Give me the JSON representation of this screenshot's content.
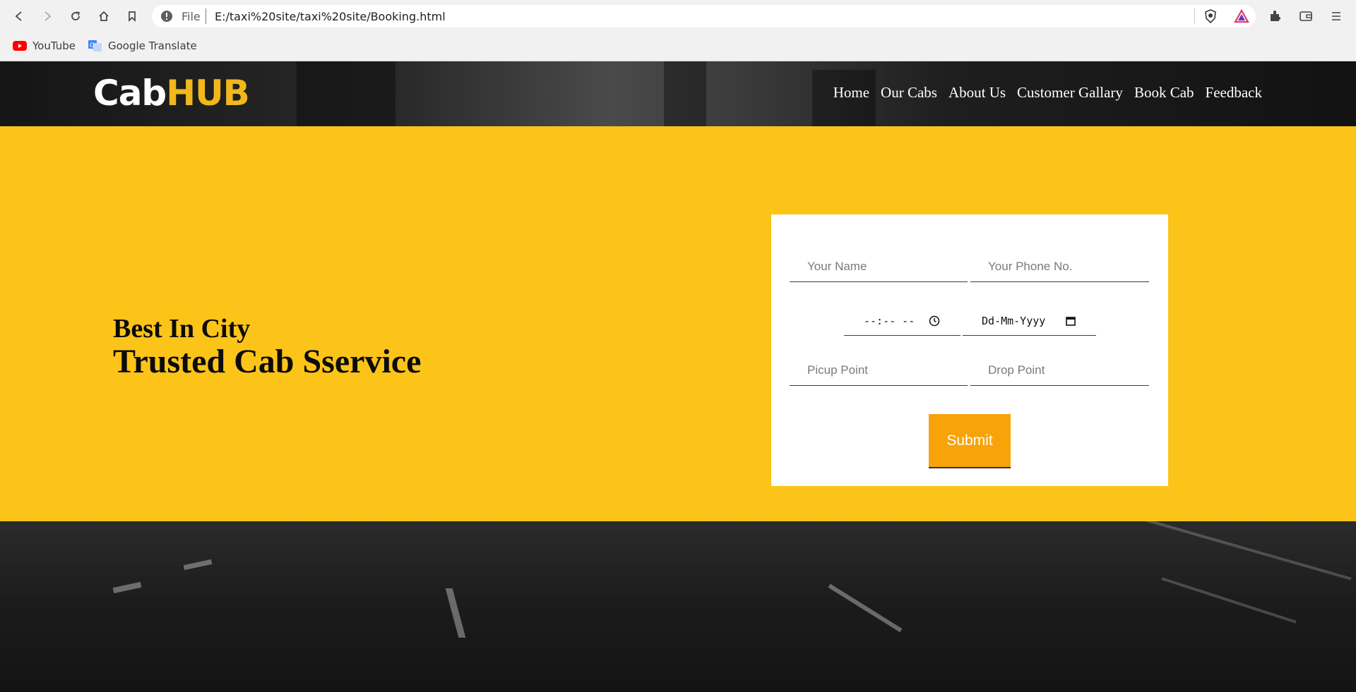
{
  "browser": {
    "file_label": "File",
    "url": "E:/taxi%20site/taxi%20site/Booking.html",
    "bookmarks": [
      {
        "label": "YouTube",
        "icon": "youtube-icon"
      },
      {
        "label": "Google Translate",
        "icon": "google-translate-icon"
      }
    ]
  },
  "site": {
    "logo_part1": "Cab",
    "logo_part2": "HUB",
    "nav": [
      "Home",
      "Our Cabs",
      "About Us",
      "Customer Gallary",
      "Book Cab",
      "Feedback"
    ],
    "tagline_small": "Best In City",
    "tagline_large": "Trusted Cab Sservice",
    "colors": {
      "accent": "#fcc419",
      "logo_hub": "#f1b81b",
      "submit": "#f8a309"
    }
  },
  "form": {
    "name_placeholder": "Your Name",
    "phone_placeholder": "Your Phone No.",
    "time_value": "--:-- --",
    "date_value": "Dd-Mm-Yyyy",
    "pickup_placeholder": "Picup Point",
    "drop_placeholder": "Drop Point",
    "submit_label": "Submit"
  }
}
